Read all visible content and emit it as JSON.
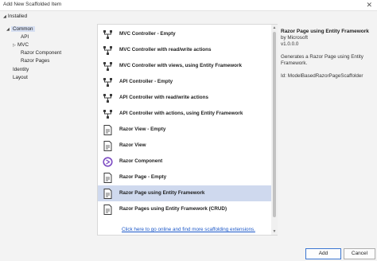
{
  "window": {
    "title": "Add New Scaffolded Item",
    "close_glyph": "✕"
  },
  "installed_label": "Installed",
  "tree": {
    "items": [
      {
        "label": "Common",
        "expander": "◢",
        "selected": true
      },
      {
        "label": "API",
        "expander": "",
        "selected": false
      },
      {
        "label": "MVC",
        "expander": "▷",
        "selected": false
      },
      {
        "label": "Razor Component",
        "expander": "",
        "selected": false
      },
      {
        "label": "Razor Pages",
        "expander": "",
        "selected": false
      },
      {
        "label": "Identity",
        "expander": "",
        "selected": false
      },
      {
        "label": "Layout",
        "expander": "",
        "selected": false
      }
    ]
  },
  "templates": {
    "items": [
      {
        "label": "MVC Controller - Empty",
        "icon": "controller-icon"
      },
      {
        "label": "MVC Controller with read/write actions",
        "icon": "controller-icon"
      },
      {
        "label": "MVC Controller with views, using Entity Framework",
        "icon": "controller-icon"
      },
      {
        "label": "API Controller - Empty",
        "icon": "controller-icon"
      },
      {
        "label": "API Controller with read/write actions",
        "icon": "controller-icon"
      },
      {
        "label": "API Controller with actions, using Entity Framework",
        "icon": "controller-icon"
      },
      {
        "label": "Razor View - Empty",
        "icon": "razor-page-icon"
      },
      {
        "label": "Razor View",
        "icon": "razor-page-icon"
      },
      {
        "label": "Razor Component",
        "icon": "blazor-icon"
      },
      {
        "label": "Razor Page - Empty",
        "icon": "razor-page-icon"
      },
      {
        "label": "Razor Page using Entity Framework",
        "icon": "razor-page-icon",
        "selected": true
      },
      {
        "label": "Razor Pages using Entity Framework (CRUD)",
        "icon": "razor-page-icon"
      }
    ],
    "online_link": "Click here to go online and find more scaffolding extensions."
  },
  "details": {
    "title": "Razor Page using Entity Framework",
    "by": "by Microsoft",
    "version": "v1.0.0.0",
    "description": "Generates a Razor Page using Entity Framework.",
    "id": "Id: ModelBasedRazorPageScaffolder"
  },
  "buttons": {
    "add": "Add",
    "cancel": "Cancel"
  },
  "colors": {
    "selection": "#cfd9ee",
    "link": "#1a57c8",
    "blazor": "#7d4cc3"
  }
}
